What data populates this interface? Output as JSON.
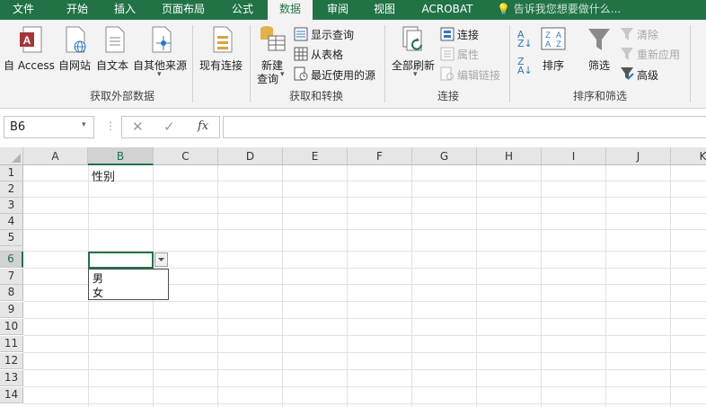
{
  "tabs": [
    {
      "label": "文件",
      "active": false
    },
    {
      "label": "开始",
      "active": false
    },
    {
      "label": "插入",
      "active": false
    },
    {
      "label": "页面布局",
      "active": false
    },
    {
      "label": "公式",
      "active": false
    },
    {
      "label": "数据",
      "active": true
    },
    {
      "label": "审阅",
      "active": false
    },
    {
      "label": "视图",
      "active": false
    },
    {
      "label": "ACROBAT",
      "active": false
    }
  ],
  "tell_me": "告诉我您想要做什么...",
  "ribbon": {
    "get_external": {
      "group_label": "获取外部数据",
      "from_access": "自 Access",
      "from_web": "自网站",
      "from_text": "自文本",
      "from_other": "自其他来源",
      "existing_connections": "现有连接"
    },
    "get_transform": {
      "group_label": "获取和转换",
      "new_query_line1": "新建",
      "new_query_line2": "查询",
      "show_queries": "显示查询",
      "from_table": "从表格",
      "recent_sources": "最近使用的源"
    },
    "connections": {
      "group_label": "连接",
      "refresh_all": "全部刷新",
      "connections": "连接",
      "properties": "属性",
      "edit_links": "编辑链接"
    },
    "sort_filter": {
      "group_label": "排序和筛选",
      "sort": "排序",
      "filter": "筛选",
      "clear": "清除",
      "reapply": "重新应用",
      "advanced": "高级"
    }
  },
  "formula_bar": {
    "name_box": "B6",
    "fx_label": "fx",
    "formula": ""
  },
  "grid": {
    "columns": [
      "A",
      "B",
      "C",
      "D",
      "E",
      "F",
      "G",
      "H",
      "I",
      "J",
      "K"
    ],
    "selected_column": "B",
    "rows": [
      "1",
      "2",
      "3",
      "4",
      "5",
      "6",
      "7",
      "8",
      "9",
      "10",
      "11",
      "12",
      "13",
      "14"
    ],
    "selected_row": "6",
    "cells": {
      "B1": "性别"
    }
  },
  "dropdown": {
    "options": [
      "男",
      "女"
    ]
  },
  "colors": {
    "excel_green": "#217346"
  }
}
